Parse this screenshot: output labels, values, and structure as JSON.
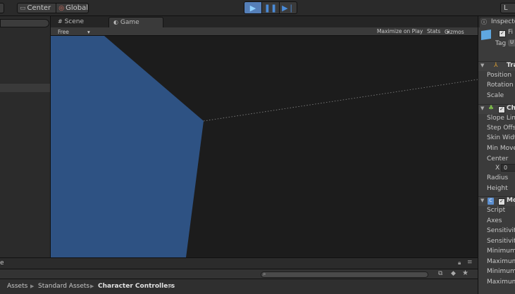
{
  "toolbar": {
    "pivot_label": "Center",
    "space_label": "Global",
    "layers_label": "L"
  },
  "game_view": {
    "scene_tab": "Scene",
    "game_tab": "Game",
    "aspect": "Free Aspect",
    "maximize_on_play": "Maximize on Play",
    "stats": "Stats",
    "gizmos": "Gizmos",
    "shape_color": "#2e5283"
  },
  "inspector": {
    "tab_label": "Inspecto",
    "object_name_partial": "Fi",
    "tag_label": "Tag",
    "tag_value": "U",
    "transform": {
      "header": "Tra",
      "rows": [
        "Position",
        "Rotation",
        "Scale"
      ]
    },
    "character_controller": {
      "header": "Ch",
      "rows": [
        "Slope Lim",
        "Step Offs",
        "Skin Widt",
        "Min Move",
        "Center"
      ],
      "center_x_label": "X",
      "center_x_value": "0",
      "rows2": [
        "Radius",
        "Height"
      ]
    },
    "mouse_look": {
      "header": "Mo",
      "rows": [
        "Script",
        "Axes",
        "Sensitivity",
        "Sensitivity",
        "Minimum",
        "Maximum",
        "Minimum",
        "Maximum"
      ]
    }
  },
  "bottom": {
    "panel_label_partial": "e",
    "breadcrumbs": [
      "Assets",
      "Standard Assets",
      "Character Controllers"
    ]
  }
}
